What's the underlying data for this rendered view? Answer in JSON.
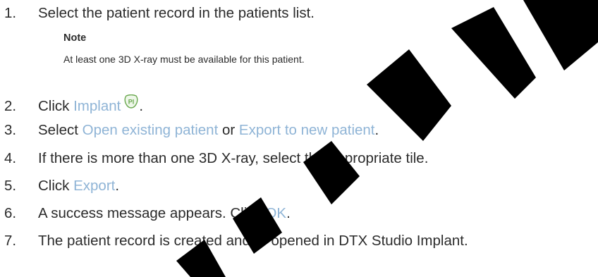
{
  "steps": [
    {
      "num": "1.",
      "parts": [
        {
          "text": "Select the patient record in the patients list."
        }
      ]
    },
    {
      "num": "2.",
      "parts": [
        {
          "text": "Click "
        },
        {
          "text": "Implant",
          "hl": true
        },
        {
          "icon": "pi"
        },
        {
          "text": "."
        }
      ]
    },
    {
      "num": "3.",
      "parts": [
        {
          "text": "Select "
        },
        {
          "text": "Open existing patient",
          "hl": true
        },
        {
          "text": " or "
        },
        {
          "text": "Export to new patient",
          "hl": true
        },
        {
          "text": "."
        }
      ]
    },
    {
      "num": "4.",
      "parts": [
        {
          "text": "If there is more than one 3D X-ray, select the appropriate tile."
        }
      ]
    },
    {
      "num": "5.",
      "parts": [
        {
          "text": "Click "
        },
        {
          "text": "Export",
          "hl": true
        },
        {
          "text": "."
        }
      ]
    },
    {
      "num": "6.",
      "parts": [
        {
          "text": "A success message appears. Click "
        },
        {
          "text": "OK",
          "hl": true
        },
        {
          "text": "."
        }
      ]
    },
    {
      "num": "7.",
      "parts": [
        {
          "text": "The patient record is created and/or opened in DTX Studio Implant."
        }
      ]
    }
  ],
  "note": {
    "title": "Note",
    "text": "At least one 3D X-ray must be available for this patient."
  },
  "icons": {
    "implant": {
      "name": "implant-pi-icon",
      "glyph": "PI",
      "color": "#6aa84f"
    }
  },
  "colors": {
    "text": "#2b2b2b",
    "highlight": "#8fb4d6",
    "watermark": "#000000"
  }
}
